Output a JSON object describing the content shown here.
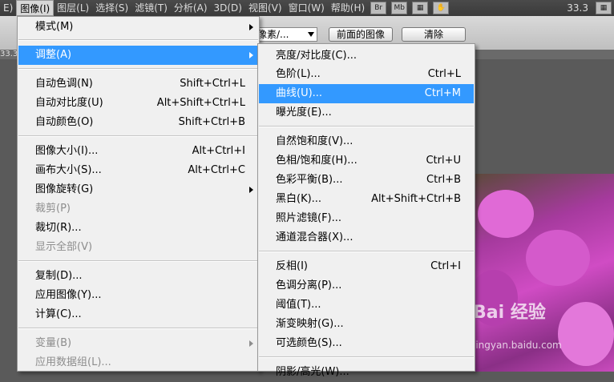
{
  "menubar": {
    "items": [
      "E)",
      "图像(I)",
      "图层(L)",
      "选择(S)",
      "滤镜(T)",
      "分析(A)",
      "3D(D)",
      "视图(V)",
      "窗口(W)",
      "帮助(H)"
    ],
    "br_label": "Br",
    "mb_label": "Mb",
    "zoom": "33.3"
  },
  "options": {
    "sample_value": "像素/...",
    "front_image_button": "前面的图像",
    "clear_button": "清除"
  },
  "tabstrip": {
    "zoom_label": "33.3"
  },
  "watermark": {
    "brand": "Bai 经验",
    "url": "jingyan.baidu.com"
  },
  "image_menu": {
    "mode": "模式(M)",
    "adjust": "调整(A)",
    "auto_tone": "自动色调(N)",
    "auto_tone_sc": "Shift+Ctrl+L",
    "auto_contrast": "自动对比度(U)",
    "auto_contrast_sc": "Alt+Shift+Ctrl+L",
    "auto_color": "自动颜色(O)",
    "auto_color_sc": "Shift+Ctrl+B",
    "image_size": "图像大小(I)...",
    "image_size_sc": "Alt+Ctrl+I",
    "canvas_size": "画布大小(S)...",
    "canvas_size_sc": "Alt+Ctrl+C",
    "rotate": "图像旋转(G)",
    "crop": "裁剪(P)",
    "trim": "裁切(R)...",
    "reveal_all": "显示全部(V)",
    "duplicate": "复制(D)...",
    "apply_image": "应用图像(Y)...",
    "calculations": "计算(C)...",
    "variables": "变量(B)",
    "apply_data_set": "应用数据组(L)..."
  },
  "adjust_menu": {
    "brightness": "亮度/对比度(C)...",
    "levels": "色阶(L)...",
    "levels_sc": "Ctrl+L",
    "curves": "曲线(U)...",
    "curves_sc": "Ctrl+M",
    "exposure": "曝光度(E)...",
    "vibrance": "自然饱和度(V)...",
    "hue_sat": "色相/饱和度(H)...",
    "hue_sat_sc": "Ctrl+U",
    "color_balance": "色彩平衡(B)...",
    "color_balance_sc": "Ctrl+B",
    "black_white": "黑白(K)...",
    "black_white_sc": "Alt+Shift+Ctrl+B",
    "photo_filter": "照片滤镜(F)...",
    "channel_mixer": "通道混合器(X)...",
    "invert": "反相(I)",
    "invert_sc": "Ctrl+I",
    "posterize": "色调分离(P)...",
    "threshold": "阈值(T)...",
    "gradient_map": "渐变映射(G)...",
    "selective_color": "可选颜色(S)...",
    "shadows_highlights": "阴影/高光(W)..."
  }
}
